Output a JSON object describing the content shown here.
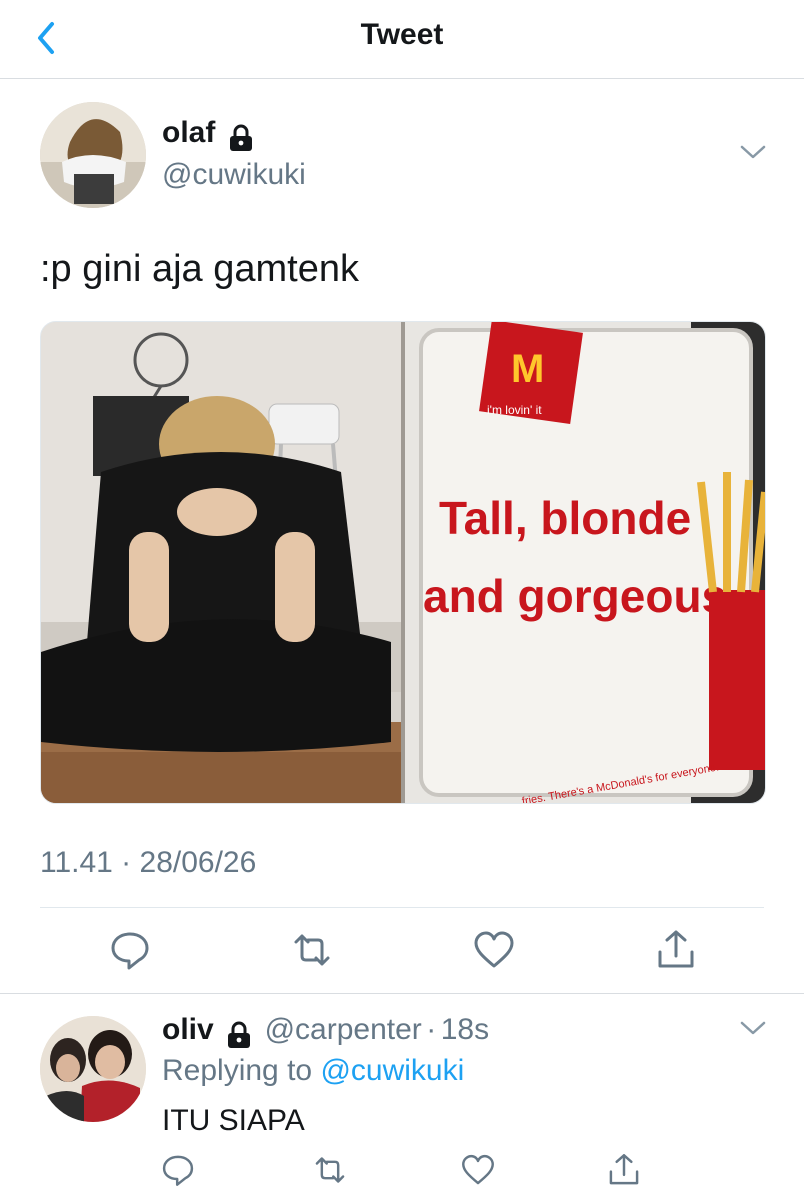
{
  "header": {
    "title": "Tweet"
  },
  "tweet": {
    "author_name": "olaf",
    "author_handle": "@cuwikuki",
    "text": ":p gini aja gamtenk",
    "timestamp": "11.41 · 28/06/26",
    "media": {
      "sign_brand_tagline": "i'm lovin' it",
      "sign_headline_line1": "Tall, blonde",
      "sign_headline_line2": "and gorgeous.",
      "sign_footer": "fries. There's a McDonald's for everyone."
    }
  },
  "reply": {
    "author_name": "oliv",
    "author_handle": "@carpenter",
    "separator": "·",
    "time_ago": "18s",
    "replying_to_prefix": "Replying to",
    "replying_to_handle": "@cuwikuki",
    "text": "ITU SIAPA"
  },
  "icons": {
    "back": "chevron-left-icon",
    "lock": "lock-icon",
    "menu": "chevron-down-icon",
    "reply": "comment-icon",
    "retweet": "retweet-icon",
    "like": "heart-icon",
    "share": "share-icon"
  },
  "colors": {
    "accent": "#1da1f2",
    "muted": "#657786",
    "mcd_red": "#c8161d",
    "mcd_yellow": "#ffc72c"
  }
}
